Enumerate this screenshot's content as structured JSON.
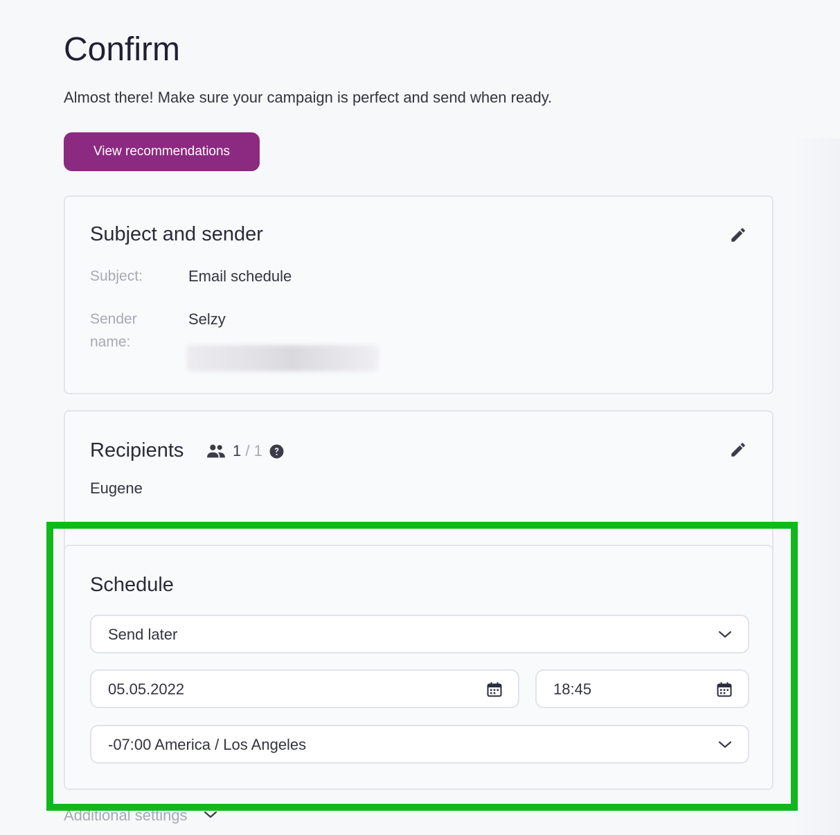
{
  "page": {
    "title": "Confirm",
    "subtitle": "Almost there! Make sure your campaign is perfect and send when ready.",
    "recommendations_button": "View recommendations"
  },
  "subject_card": {
    "title": "Subject and sender",
    "edit_icon": "pencil-icon",
    "subject_label": "Subject:",
    "subject_value": "Email schedule",
    "sender_label_line1": "Sender",
    "sender_label_line2": "name:",
    "sender_value": "Selzy"
  },
  "recipients_card": {
    "title": "Recipients",
    "group_icon": "people-icon",
    "count_current": "1",
    "count_separator": "/",
    "count_total": "1",
    "help_icon": "question-circle-icon",
    "edit_icon": "pencil-icon",
    "recipient_name": "Eugene"
  },
  "schedule_card": {
    "title": "Schedule",
    "send_mode": "Send later",
    "date_value": "05.05.2022",
    "time_value": "18:45",
    "timezone": "-07:00 America / Los Angeles",
    "calendar_icon": "calendar-icon",
    "chevron_icon": "chevron-down-icon"
  },
  "additional_settings": {
    "label": "Additional settings"
  },
  "colors": {
    "accent": "#8b2a80",
    "highlight": "#10b81c",
    "background": "#f7f8fa"
  }
}
